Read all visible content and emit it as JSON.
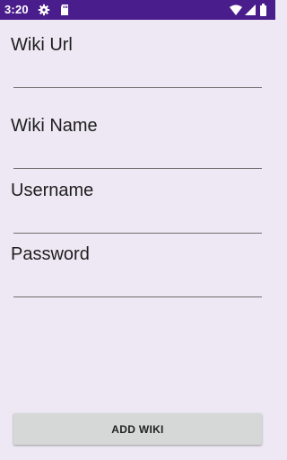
{
  "status_bar": {
    "time": "3:20",
    "icons": [
      "gear-icon",
      "sd-card-icon",
      "wifi-icon",
      "signal-icon",
      "battery-icon"
    ],
    "background_color": "#4a1d8c"
  },
  "form": {
    "fields": [
      {
        "label": "Wiki Url",
        "value": ""
      },
      {
        "label": "Wiki Name",
        "value": ""
      },
      {
        "label": "Username",
        "value": ""
      },
      {
        "label": "Password",
        "value": ""
      }
    ]
  },
  "actions": {
    "add_wiki_label": "ADD WIKI"
  },
  "colors": {
    "background": "#ede8f3",
    "button": "#d6d7d7"
  }
}
